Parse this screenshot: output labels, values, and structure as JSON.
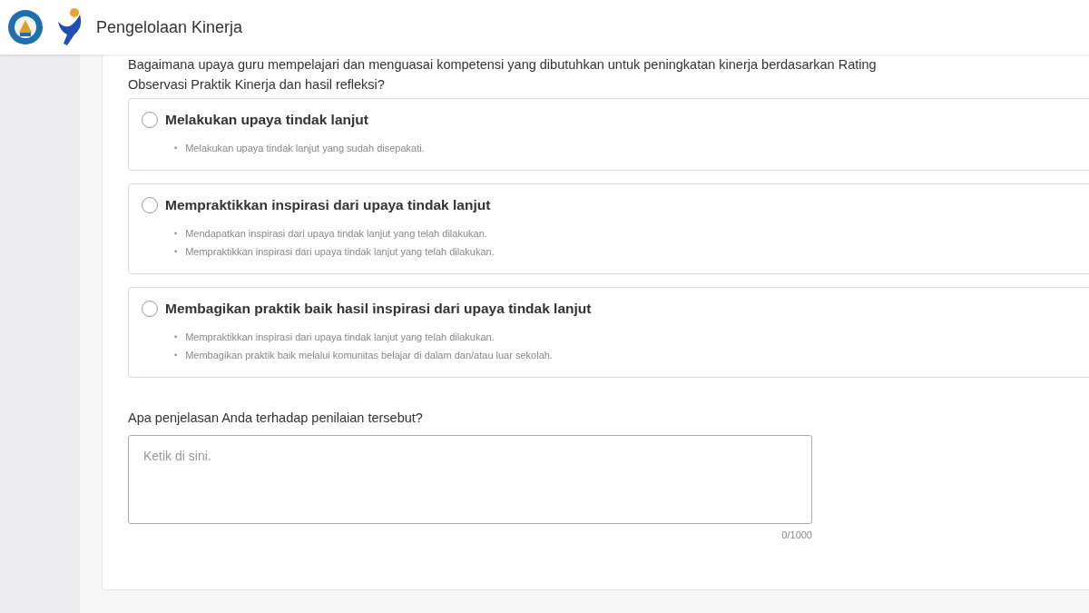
{
  "header": {
    "title": "Pengelolaan Kinerja"
  },
  "question": "Bagaimana upaya guru mempelajari dan menguasai kompetensi yang dibutuhkan untuk peningkatan kinerja berdasarkan Rating\nObservasi Praktik Kinerja dan hasil refleksi?",
  "options": [
    {
      "label": "Melakukan upaya tindak lanjut",
      "selected": false,
      "points": [
        {
          "marker": "•",
          "text": "Melakukan upaya tindak lanjut yang sudah disepakati."
        }
      ]
    },
    {
      "label": "Mempraktikkan inspirasi dari upaya tindak lanjut",
      "selected": false,
      "points": [
        {
          "marker": "•",
          "text": "Mendapatkan inspirasi dari upaya tindak lanjut yang telah dilakukan."
        },
        {
          "marker": "•",
          "text": "Mempraktikkan inspirasi dari upaya tindak lanjut yang telah dilakukan."
        }
      ]
    },
    {
      "label": "Membagikan praktik baik hasil inspirasi dari upaya tindak lanjut",
      "selected": false,
      "points": [
        {
          "marker": "•",
          "text": "Mempraktikkan inspirasi dari upaya tindak lanjut yang telah dilakukan."
        },
        {
          "marker": "•",
          "text": "Membagikan praktik baik melalui komunitas belajar di dalam dan/atau luar sekolah."
        }
      ]
    }
  ],
  "explanation": {
    "label": "Apa penjelasan Anda terhadap penilaian tersebut?",
    "placeholder": "Ketik di sini.",
    "counter": "0/1000"
  }
}
